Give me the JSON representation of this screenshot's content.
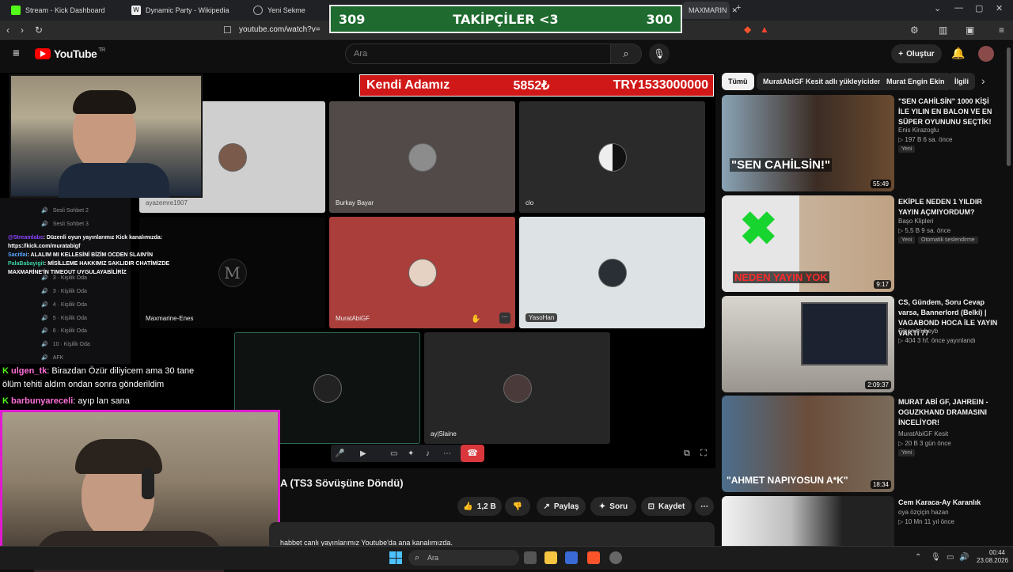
{
  "browser": {
    "tabs": [
      {
        "label": "Stream - Kick Dashboard"
      },
      {
        "label": "Dynamic Party - Wikipedia"
      },
      {
        "label": "Yeni Sekme"
      },
      {
        "label": "MAXMARIN"
      }
    ],
    "url": "youtube.com/watch?v="
  },
  "overlay": {
    "left": "309",
    "title": "TAKİPÇİLER <3",
    "right": "300"
  },
  "youtube": {
    "logo": "YouTube",
    "region": "TR",
    "search_placeholder": "Ara",
    "create_label": "Oluştur"
  },
  "banner": {
    "name": "Kendi Adamız",
    "amount": "5852₺",
    "total": "TRY1533000000"
  },
  "participants": [
    {
      "name": "ayazemre1907"
    },
    {
      "name": "Burkay Bayar"
    },
    {
      "name": "clo"
    },
    {
      "name": "Maxmarine-Enes"
    },
    {
      "name": "MuratAbiGF"
    },
    {
      "name": "YasoHan"
    },
    {
      "name": ""
    },
    {
      "name": "ay|Slaine"
    }
  ],
  "voice_rooms": [
    "Sesli Sohbet 2",
    "Sesli Sohbet 3",
    "3 · Kişilik Oda",
    "3 · Kişilik Oda",
    "4 · Kişilik Oda",
    "5 · Kişilik Oda",
    "6 · Kişilik Oda",
    "10 · Kişilik Oda",
    "AFK"
  ],
  "small_chat": [
    {
      "user": "@Streamlabs",
      "text": ": Düzenli oyun yayınlarımız Kick kanalımızda: https://kick.com/muratabigf"
    },
    {
      "user": "Sacitlai",
      "text": ": ALALIM MI KELLESİNİ BİZİM OCDEN SLAIN'İN"
    },
    {
      "user": "PalaBabayigit",
      "text": ": MİSİLLEME HAKKIMIZ SAKLIDIR CHATİMİZDE MAXMARİNE'İN TIMEOUT UYGULAYABİLİRİZ"
    }
  ],
  "chat": [
    {
      "user": "ulgen_tk",
      "text": ": Birazdan Özür diliyicem ama 30 tane",
      "cont": "ölüm tehiti aldım ondan sonra gönderildim"
    },
    {
      "user": "barbunyareceli",
      "text": ": ayıp lan sana"
    }
  ],
  "video": {
    "title": "A (TS3 Sövüşüne Döndü)",
    "likes": "1,2 B",
    "share": "Paylaş",
    "ask": "Soru",
    "save": "Kaydet",
    "desc": "habbet canlı yayınlarımız Youtube'da ana kanalımızda."
  },
  "chips": [
    "Tümü",
    "MuratAbiGF Kesit adlı yükleyiciden",
    "Murat Engin Ekin",
    "İlgili"
  ],
  "recommendations": [
    {
      "title": "\"SEN CAHİLSİN\" 1000 KİŞİ İLE YILIN EN BALON VE EN SÜPER OYUNUNU SEÇTİK!",
      "channel": "Enis Kirazoglu",
      "meta": "▷ 197 B  6 sa. önce",
      "badge": "Yeni",
      "duration": "55:49",
      "overlay_text": "\"SEN CAHİLSİN!\""
    },
    {
      "title": "EKİPLE NEDEN 1 YILDIR YAYIN AÇMIYORDUM?",
      "channel": "Başo Klipleri",
      "meta": "▷ 5,5 B  9 sa. önce",
      "badge": "Yeni",
      "badge2": "Otomatik seslendirme",
      "duration": "9:17",
      "overlay_text": "NEDEN YAYIN YOK"
    },
    {
      "title": "CS, Gündem, Soru Cevap varsa, Bannerlord (Belki) | VAGABOND HOCA İLE YAYIN VAKTİ 77",
      "channel": "Sinan Hubeyb",
      "meta": "▷ 404  3 hf. önce yayınlandı",
      "duration": "2:09:37"
    },
    {
      "title": "MURAT ABİ GF, JAHREIN - OGUZKHAND DRAMASINI İNCELİYOR!",
      "channel": "MuratAbiGF Kesit",
      "meta": "▷ 20 B  3 gün önce",
      "badge": "Yeni",
      "duration": "18:34",
      "overlay_text": "\"AHMET NAPIYOSUN A*K\""
    },
    {
      "title": "Cem Karaca-Ay Karanlık",
      "channel": "oya özçiçin hazan",
      "meta": "▷ 10 Mn  11 yıl önce"
    }
  ],
  "taskbar": {
    "search": "Ara",
    "time": "00:44",
    "date": "23.08.2026"
  },
  "colors": {
    "overlay_green": "#1f6b2f",
    "banner_red": "#d11818",
    "webcam_border": "#e01ad0",
    "yt_red": "#ff0000"
  }
}
